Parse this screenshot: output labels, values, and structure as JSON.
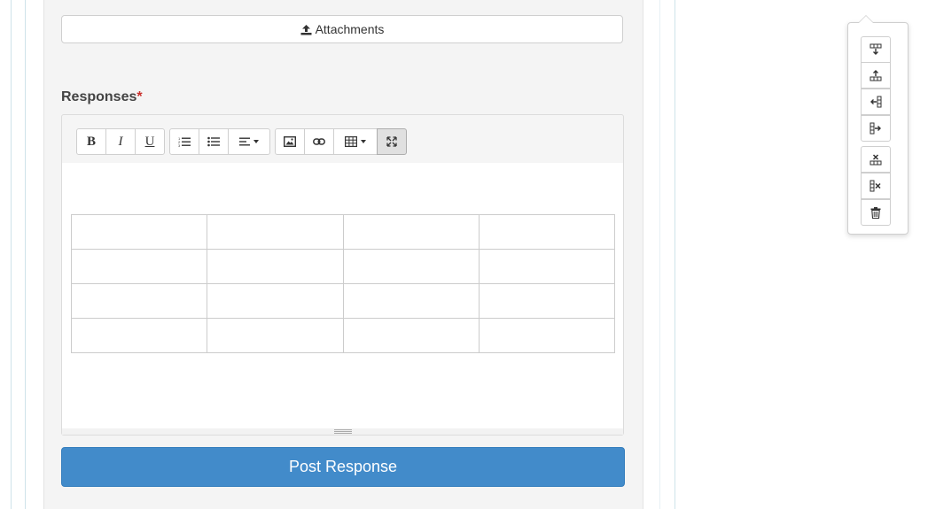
{
  "form": {
    "attachments_label": "Attachments",
    "responses_label": "Responses",
    "required_mark": "*",
    "post_button_label": "Post Response"
  },
  "editor": {
    "toolbar": [
      {
        "name": "bold",
        "label": "B"
      },
      {
        "name": "italic",
        "label": "I"
      },
      {
        "name": "underline",
        "label": "U"
      },
      {
        "name": "ordered-list",
        "icon": "ordered-list-icon"
      },
      {
        "name": "unordered-list",
        "icon": "unordered-list-icon"
      },
      {
        "name": "paragraph-align",
        "icon": "align-left-icon"
      },
      {
        "name": "insert-picture",
        "icon": "picture-icon"
      },
      {
        "name": "insert-link",
        "icon": "link-icon"
      },
      {
        "name": "insert-table",
        "icon": "table-icon"
      },
      {
        "name": "fullscreen",
        "icon": "fullscreen-icon",
        "active": true
      }
    ],
    "table": {
      "rows": 4,
      "cols": 4
    }
  },
  "table_popover": {
    "buttons": [
      {
        "name": "add-row-below",
        "icon": "row-below-icon"
      },
      {
        "name": "add-row-above",
        "icon": "row-above-icon"
      },
      {
        "name": "add-col-left",
        "icon": "col-left-icon"
      },
      {
        "name": "add-col-right",
        "icon": "col-right-icon"
      },
      {
        "name": "delete-row",
        "icon": "delete-row-icon"
      },
      {
        "name": "delete-col",
        "icon": "delete-col-icon"
      },
      {
        "name": "delete-table",
        "icon": "trash-icon"
      }
    ]
  },
  "colors": {
    "primary": "#428bca",
    "required": "#c9302c",
    "panel_bg": "#f4f4f4"
  }
}
